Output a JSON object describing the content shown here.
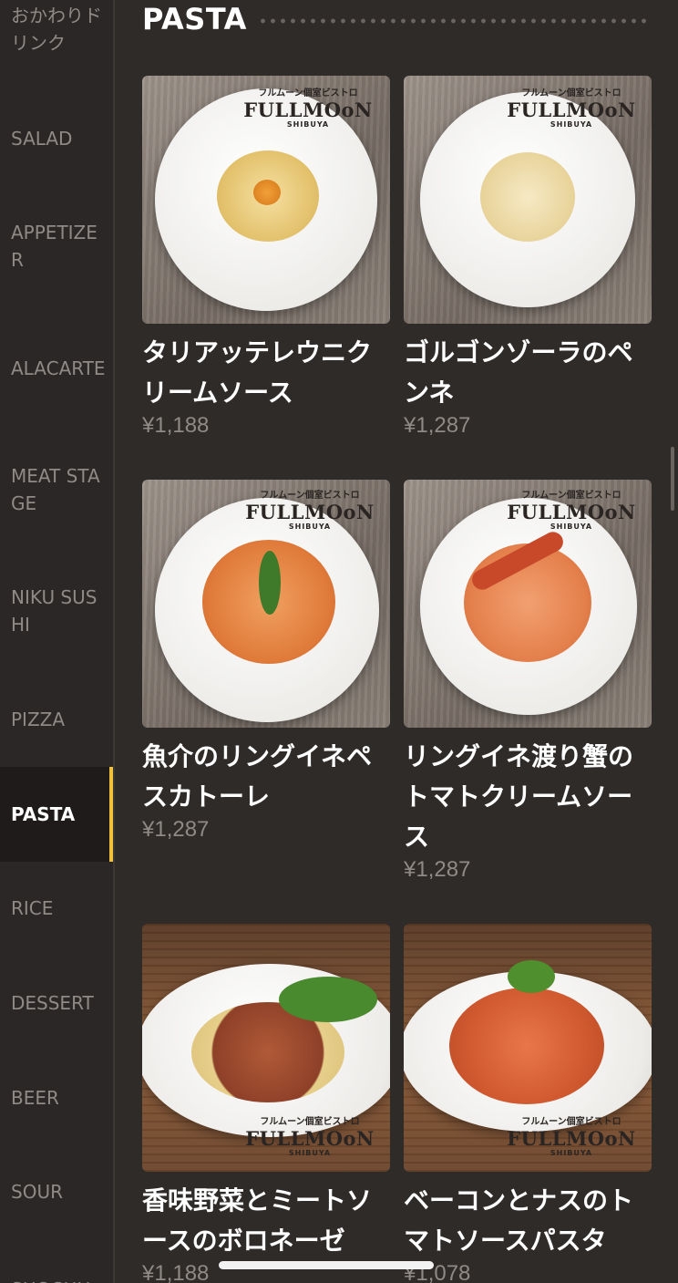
{
  "sidebar": {
    "items": [
      {
        "label": "おかわりドリンク"
      },
      {
        "label": "SALAD"
      },
      {
        "label": "APPETIZER"
      },
      {
        "label": "ALACARTE"
      },
      {
        "label": "MEAT STAGE"
      },
      {
        "label": "NIKU SUSHI"
      },
      {
        "label": "PIZZA"
      },
      {
        "label": "PASTA",
        "active": true
      },
      {
        "label": "RICE"
      },
      {
        "label": "DESSERT"
      },
      {
        "label": "BEER"
      },
      {
        "label": "SOUR"
      },
      {
        "label": "SHOCHU"
      }
    ]
  },
  "section": {
    "title": "PASTA"
  },
  "brand": {
    "jp": "フルムーン個室ビストロ",
    "en": "FULLMOoN",
    "sub": "SHIBUYA"
  },
  "items": [
    {
      "name": "タリアッテレウニクリームソース",
      "price": "¥1,188"
    },
    {
      "name": "ゴルゴンゾーラのペンネ",
      "price": "¥1,287"
    },
    {
      "name": "魚介のリングイネペスカトーレ",
      "price": "¥1,287"
    },
    {
      "name": "リングイネ渡り蟹のトマトクリームソース",
      "price": "¥1,287"
    },
    {
      "name": "香味野菜とミートソースのボロネーゼ",
      "price": "¥1,188"
    },
    {
      "name": "ベーコンとナスのトマトソースパスタ",
      "price": "¥1,078"
    }
  ],
  "colors": {
    "accent": "#f0c23a",
    "background": "#2f2b29",
    "muted_text": "#8f8a86"
  }
}
